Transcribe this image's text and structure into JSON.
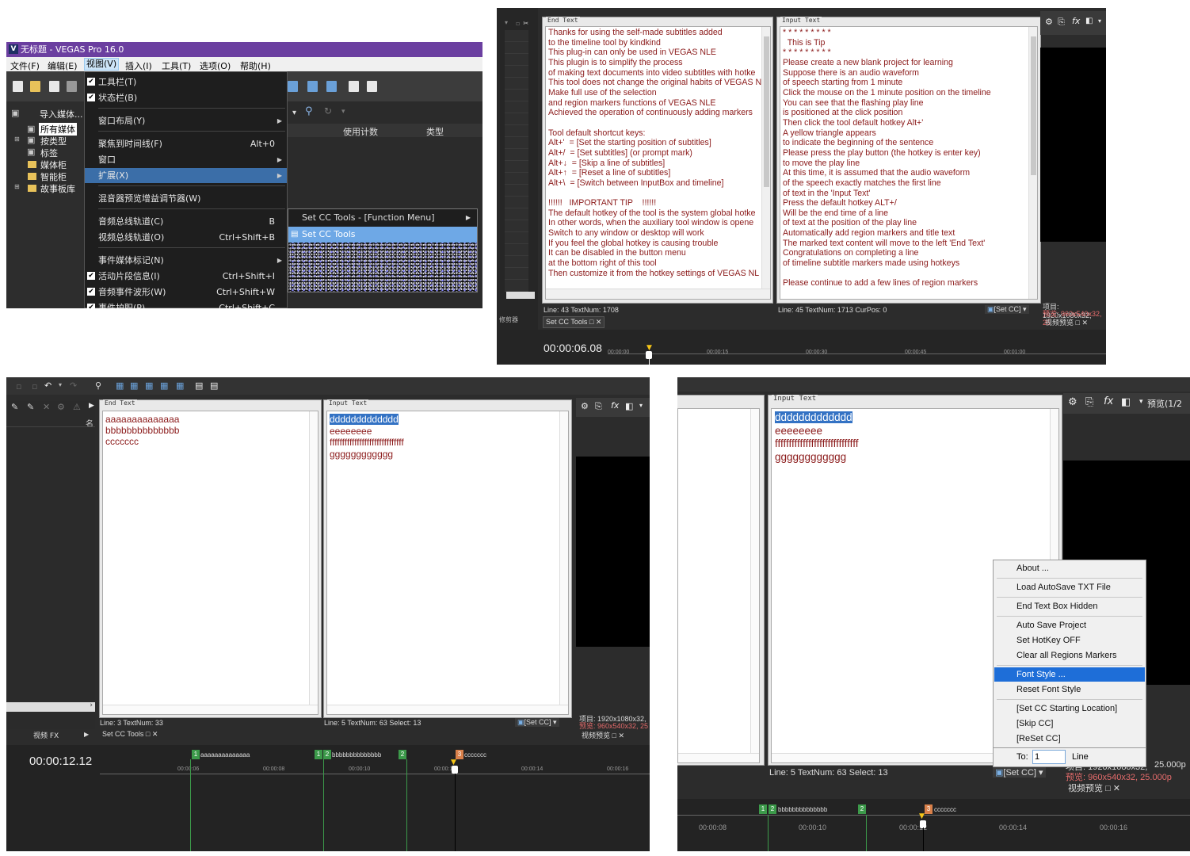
{
  "p1": {
    "window_title": "无标题 - VEGAS Pro 16.0",
    "menubar": [
      "文件(F)",
      "编辑(E)",
      "视图(V)",
      "插入(I)",
      "工具(T)",
      "选项(O)",
      "帮助(H)"
    ],
    "tree": [
      "导入媒体...",
      "所有媒体",
      "按类型",
      "标签",
      "媒体柜",
      "智能柜",
      "故事板库"
    ],
    "columns": [
      "使用计数",
      "类型"
    ],
    "view_menu": [
      {
        "label": "工具栏(T)",
        "checked": true,
        "shortcut": ""
      },
      {
        "label": "状态栏(B)",
        "checked": true,
        "shortcut": ""
      },
      {
        "label": "窗口布局(Y)",
        "checked": false,
        "shortcut": "",
        "submenu": true
      },
      {
        "label": "聚焦到时间线(F)",
        "checked": false,
        "shortcut": "Alt+0"
      },
      {
        "label": "窗口",
        "checked": false,
        "shortcut": "",
        "submenu": true
      },
      {
        "label": "扩展(X)",
        "checked": false,
        "shortcut": "",
        "submenu": true,
        "highlight": true
      },
      {
        "label": "混音器预览增益调节器(W)",
        "checked": false,
        "shortcut": ""
      },
      {
        "label": "音频总线轨道(C)",
        "checked": false,
        "shortcut": "B"
      },
      {
        "label": "视频总线轨道(O)",
        "checked": false,
        "shortcut": "Ctrl+Shift+B"
      },
      {
        "label": "事件媒体标记(N)",
        "checked": false,
        "shortcut": "",
        "submenu": true
      },
      {
        "label": "活动片段信息(I)",
        "checked": true,
        "shortcut": "Ctrl+Shift+I"
      },
      {
        "label": "音频事件波形(W)",
        "checked": true,
        "shortcut": "Ctrl+Shift+W"
      },
      {
        "label": "事件护职(P)",
        "checked": true,
        "shortcut": "Ctrl+Shift+C"
      }
    ],
    "submenu": [
      "Set CC Tools - [Function Menu]",
      "Set CC Tools"
    ]
  },
  "p2": {
    "end_text_legend": "End Text",
    "input_text_legend": "Input Text",
    "end_text_lines": [
      "Thanks for using the self-made subtitles added",
      "to the timeline tool by kindkind",
      "This plug-in can only be used in VEGAS NLE",
      "This plugin is to simplify the process",
      "of making text documents into video subtitles with hotke",
      "This tool does not change the original habits of VEGAS N",
      "Make full use of the selection",
      "and region markers functions of VEGAS NLE",
      "Achieved the operation of continuously adding markers",
      "",
      "Tool default shortcut keys:",
      "Alt+'  = [Set the starting position of subtitles]",
      "Alt+/  = [Set subtitles] (or prompt mark)",
      "Alt+↓  = [Skip a line of subtitles]",
      "Alt+↑  = [Reset a line of subtitles]",
      "Alt+\\  = [Switch between InputBox and timeline]",
      "",
      "!!!!!!   IMPORTANT TIP    !!!!!!",
      "The default hotkey of the tool is the system global hotke",
      "In other words, when the auxiliary tool window is opene",
      "Switch to any window or desktop will work",
      "If you feel the global hotkey is causing trouble",
      "It can be disabled in the button menu",
      "at the bottom right of this tool",
      "Then customize it from the hotkey settings of VEGAS NL"
    ],
    "input_text_lines": [
      "* * * * * * * * *",
      "  This is Tip",
      "* * * * * * * * *",
      "Please create a new blank project for learning",
      "Suppose there is an audio waveform",
      "of speech starting from 1 minute",
      "Click the mouse on the 1 minute position on the timeline",
      "You can see that the flashing play line",
      "is positioned at the click position",
      "Then click the tool default hotkey Alt+'",
      "A yellow triangle appears",
      "to indicate the beginning of the sentence",
      "Please press the play button (the hotkey is enter key)",
      "to move the play line",
      "At this time, it is assumed that the audio waveform",
      "of the speech exactly matches the first line",
      "of text in the 'Input Text'",
      "Press the default hotkey ALT+/",
      "Will be the end time of a line",
      "of text at the position of the play line",
      "Automatically add region markers and title text",
      "The marked text content will move to the left 'End Text'",
      "Congratulations on completing a line",
      "of timeline subtitle markers made using hotkeys",
      "",
      "Please continue to add a few lines of region markers"
    ],
    "status_left": "Line: 43  TextNum: 1708",
    "status_right": "Line: 45  TextNum: 1713  CurPos: 0",
    "setcc": "[Set CC]",
    "tab": "Set CC Tools",
    "left_tab": "修剪器",
    "preview_info1": "项目: 1920x1080x32,",
    "preview_info2": "预览: 960x540x32, 25",
    "preview_tab": "视频预览",
    "timecode": "00:00:06.08",
    "ticks": [
      "00:00:00",
      "00:00:15",
      "00:00:30",
      "00:00:45",
      "00:01:00"
    ]
  },
  "p3": {
    "end_text_legend": "End Text",
    "input_text_legend": "Input Text",
    "end_lines": [
      "aaaaaaaaaaaaaa",
      "bbbbbbbbbbbbbb",
      "ccccccc"
    ],
    "input_lines": [
      "ddddddddddddd",
      "eeeeeeee",
      "ffffffffffffffffffffffffffffff",
      "gggggggggggg"
    ],
    "status_left": "Line: 3  TextNum: 33",
    "status_right": "Line: 5  TextNum: 63  Select: 13",
    "setcc": "[Set CC]",
    "tab": "Set CC Tools",
    "fx_tab": "视频 FX",
    "name_col": "名",
    "preview_info1": "项目: 1920x1080x32,",
    "preview_info2": "预览: 960x540x32, 25",
    "preview_tab": "视频预览",
    "timecode": "00:00:12.12",
    "ticks": [
      "00:00:06",
      "00:00:08",
      "00:00:10",
      "00:00:12",
      "00:00:14",
      "00:00:16"
    ],
    "marker_labels": [
      "aaaaaaaaaaaaaa",
      "bbbbbbbbbbbbbb",
      "ccccccc"
    ]
  },
  "p4": {
    "input_text_legend": "Input Text",
    "input_lines": [
      "ddddddddddddd",
      "eeeeeeee",
      "ffffffffffffffffffffffffffffff",
      "gggggggggggg"
    ],
    "status": "Line: 5  TextNum: 63  Select: 13",
    "setcc": "[Set CC]",
    "preview_label": "预览(1/2",
    "preview_info1": "项目: 1920x1080x32,",
    "preview_info2": "预览: 960x540x32, 25.000p",
    "preview_fps": "25.000p",
    "preview_tab": "视频预览",
    "context_menu": [
      "About ...",
      "Load AutoSave TXT File",
      "End Text Box Hidden",
      "Auto Save Project",
      "Set HotKey OFF",
      "Clear all Regions Markers",
      "Font Style ...",
      "Reset Font Style",
      "[Set CC Starting Location]",
      "[Skip CC]",
      "[ReSet CC]"
    ],
    "to_label": "To:",
    "to_value": "1",
    "line_label": "Line",
    "ticks": [
      "00:00:08",
      "00:00:10",
      "00:00:12",
      "00:00:14",
      "00:00:16"
    ],
    "marker_labels": [
      "bbbbbbbbbbbbbb",
      "ccccccc"
    ]
  },
  "colors": {
    "accent_purple": "#6b3fa0",
    "highlight_blue": "#1e6ed8",
    "marker_green": "#3c9a4a",
    "marker_orange": "#d9804a",
    "text_red": "#8b1a1a"
  }
}
